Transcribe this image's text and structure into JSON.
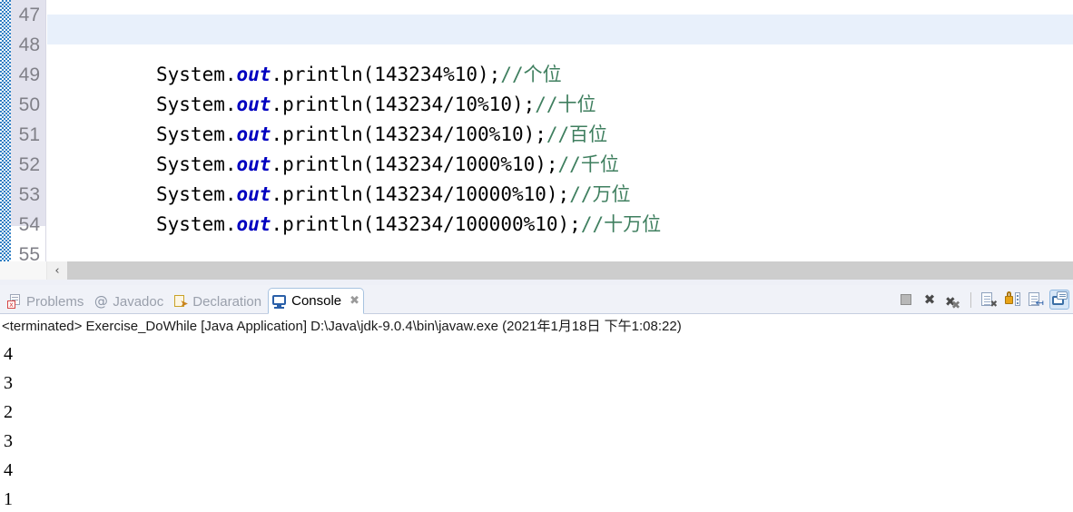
{
  "editor": {
    "line_numbers": [
      "47",
      "48",
      "49",
      "50",
      "51",
      "52",
      "53",
      "54",
      "55"
    ],
    "lines": [
      {
        "blank": true,
        "code": "",
        "comment": ""
      },
      {
        "blank": true,
        "code": "",
        "comment": ""
      },
      {
        "prefix": "System.",
        "field": "out",
        "rest": ".println(143234%10);",
        "comment": "//个位"
      },
      {
        "prefix": "System.",
        "field": "out",
        "rest": ".println(143234/10%10);",
        "comment": "//十位"
      },
      {
        "prefix": "System.",
        "field": "out",
        "rest": ".println(143234/100%10);",
        "comment": "//百位"
      },
      {
        "prefix": "System.",
        "field": "out",
        "rest": ".println(143234/1000%10);",
        "comment": "//千位"
      },
      {
        "prefix": "System.",
        "field": "out",
        "rest": ".println(143234/10000%10);",
        "comment": "//万位"
      },
      {
        "prefix": "System.",
        "field": "out",
        "rest": ".println(143234/100000%10);",
        "comment": "//十万位"
      },
      {
        "blank": true,
        "code": "",
        "comment": ""
      }
    ],
    "colors": {
      "comment": "#3f7f5f",
      "field": "#0000c0",
      "current_line_highlight": "#e8f0fb",
      "gutter": "#e2e2ed"
    },
    "scrollbar": {
      "left_arrow": "‹"
    }
  },
  "console_view": {
    "tabs": [
      {
        "label": "Problems",
        "icon": "problems-icon",
        "active": false
      },
      {
        "label": "Javadoc",
        "icon": "javadoc-icon",
        "active": false
      },
      {
        "label": "Declaration",
        "icon": "declaration-icon",
        "active": false
      },
      {
        "label": "Console",
        "icon": "console-icon",
        "active": true,
        "close": "✖"
      }
    ],
    "toolbar": [
      {
        "name": "terminate-button",
        "title": "Terminate"
      },
      {
        "name": "remove-launch-button",
        "title": "Remove Launch"
      },
      {
        "name": "remove-all-terminated-button",
        "title": "Remove All Terminated Launches"
      },
      {
        "name": "clear-console-button",
        "title": "Clear Console"
      },
      {
        "name": "scroll-lock-button",
        "title": "Scroll Lock"
      },
      {
        "name": "show-console-on-output-button",
        "title": "Show Console When Standard Out Changes"
      },
      {
        "name": "display-selected-console-button",
        "title": "Display Selected Console"
      }
    ],
    "launch_line": "<terminated> Exercise_DoWhile [Java Application] D:\\Java\\jdk-9.0.4\\bin\\javaw.exe (2021年1月18日 下午1:08:22)",
    "output_lines": [
      "4",
      "3",
      "2",
      "3",
      "4",
      "1"
    ]
  }
}
